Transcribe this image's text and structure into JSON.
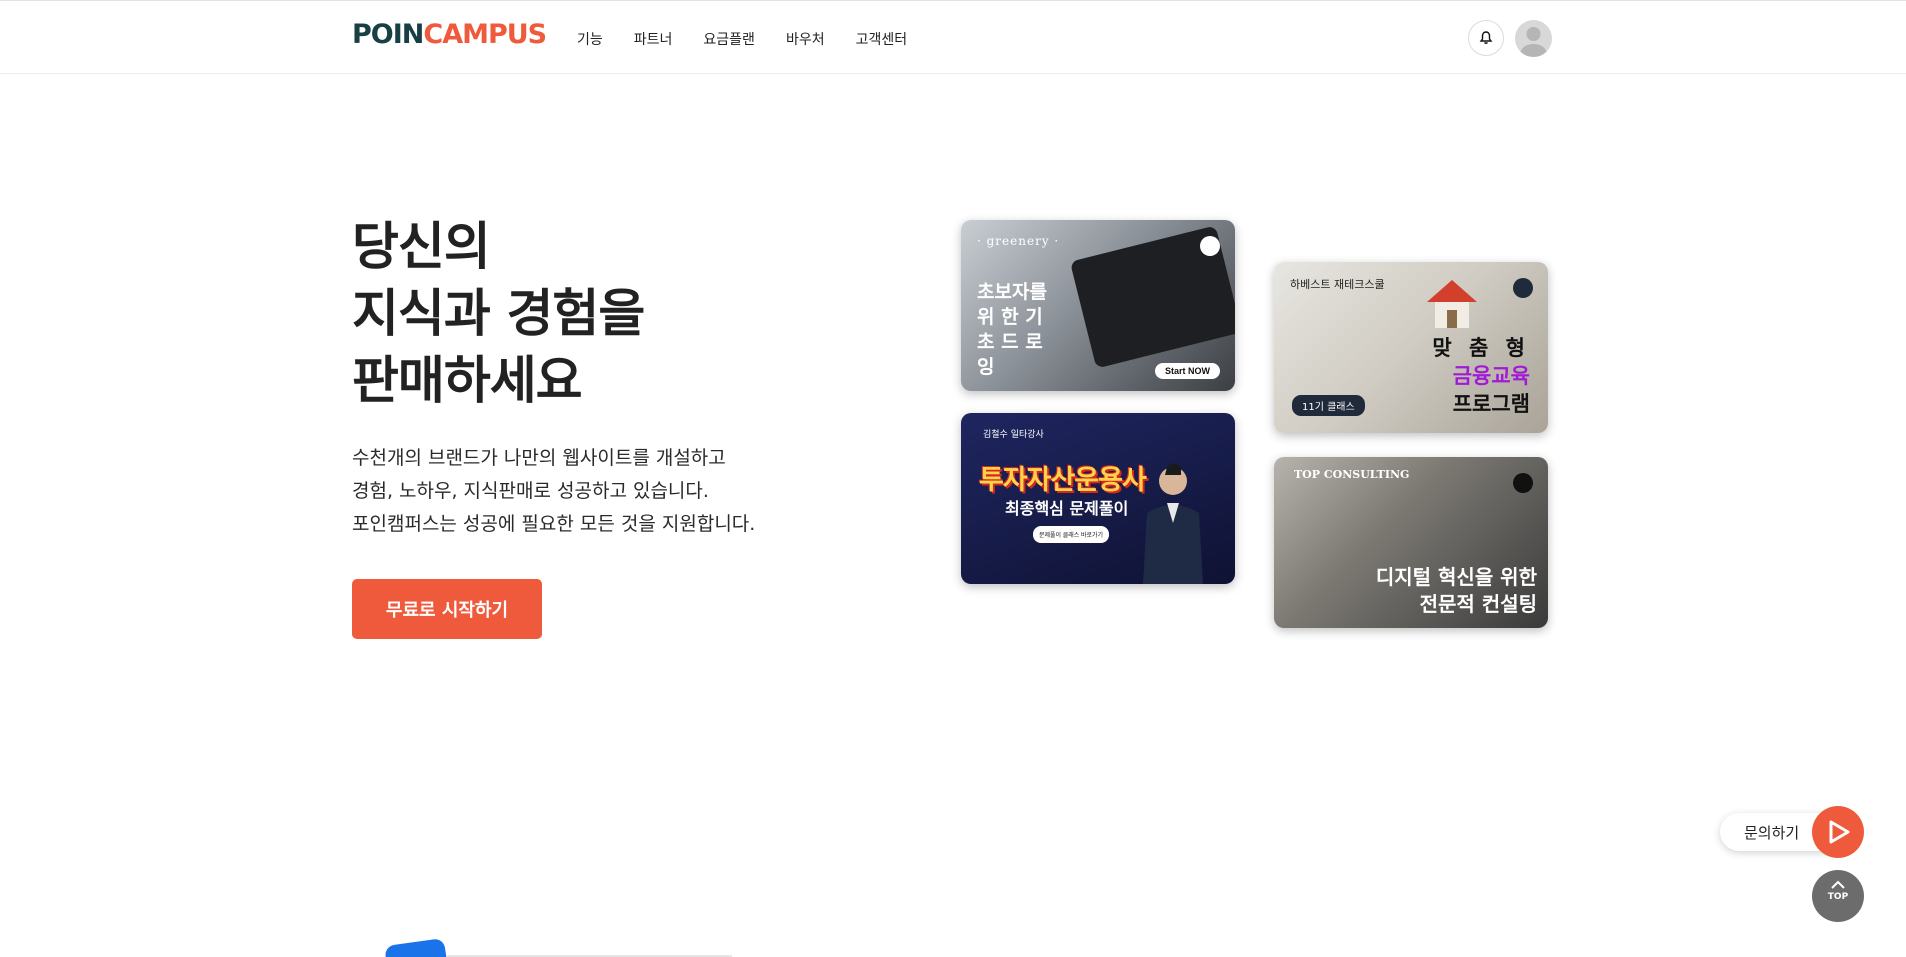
{
  "header": {
    "logo_part1": "POIN",
    "logo_part2": "CAMPUS",
    "nav": [
      "기능",
      "파트너",
      "요금플랜",
      "바우처",
      "고객센터"
    ]
  },
  "hero": {
    "title_lines": [
      "당신의",
      "지식과 경험을",
      "판매하세요"
    ],
    "desc_lines": [
      "수천개의 브랜드가 나만의 웹사이트를 개설하고",
      "경험, 노하우, 지식판매로 성공하고 있습니다.",
      "포인캠퍼스는 성공에 필요한 모든 것을 지원합니다."
    ],
    "cta_label": "무료로 시작하기"
  },
  "cards": {
    "greenery": {
      "brand": "· greenery ·",
      "text": "초보자를 위 한 기 초 드 로 잉",
      "button": "Start NOW"
    },
    "invest": {
      "brand": "김철수 일타강사",
      "title": "투자자산운용사",
      "subtitle": "최종핵심 문제풀이",
      "pill": "문제풀이 클래스 바로가기"
    },
    "finance": {
      "brand": "하베스트 재테크스쿨",
      "line1": "맞 춤 형",
      "line2": "금융교육",
      "line3": "프로그램",
      "badge": "11기 클래스"
    },
    "consulting": {
      "brand": "TOP CONSULTING",
      "line1": "디지털 혁신을 위한",
      "line2": "전문적 컨설팅"
    }
  },
  "floating": {
    "inquiry_label": "문의하기",
    "top_label": "TOP"
  },
  "colors": {
    "accent": "#f05a3c",
    "logo_dark": "#183f44",
    "purple": "#a11ad6"
  }
}
